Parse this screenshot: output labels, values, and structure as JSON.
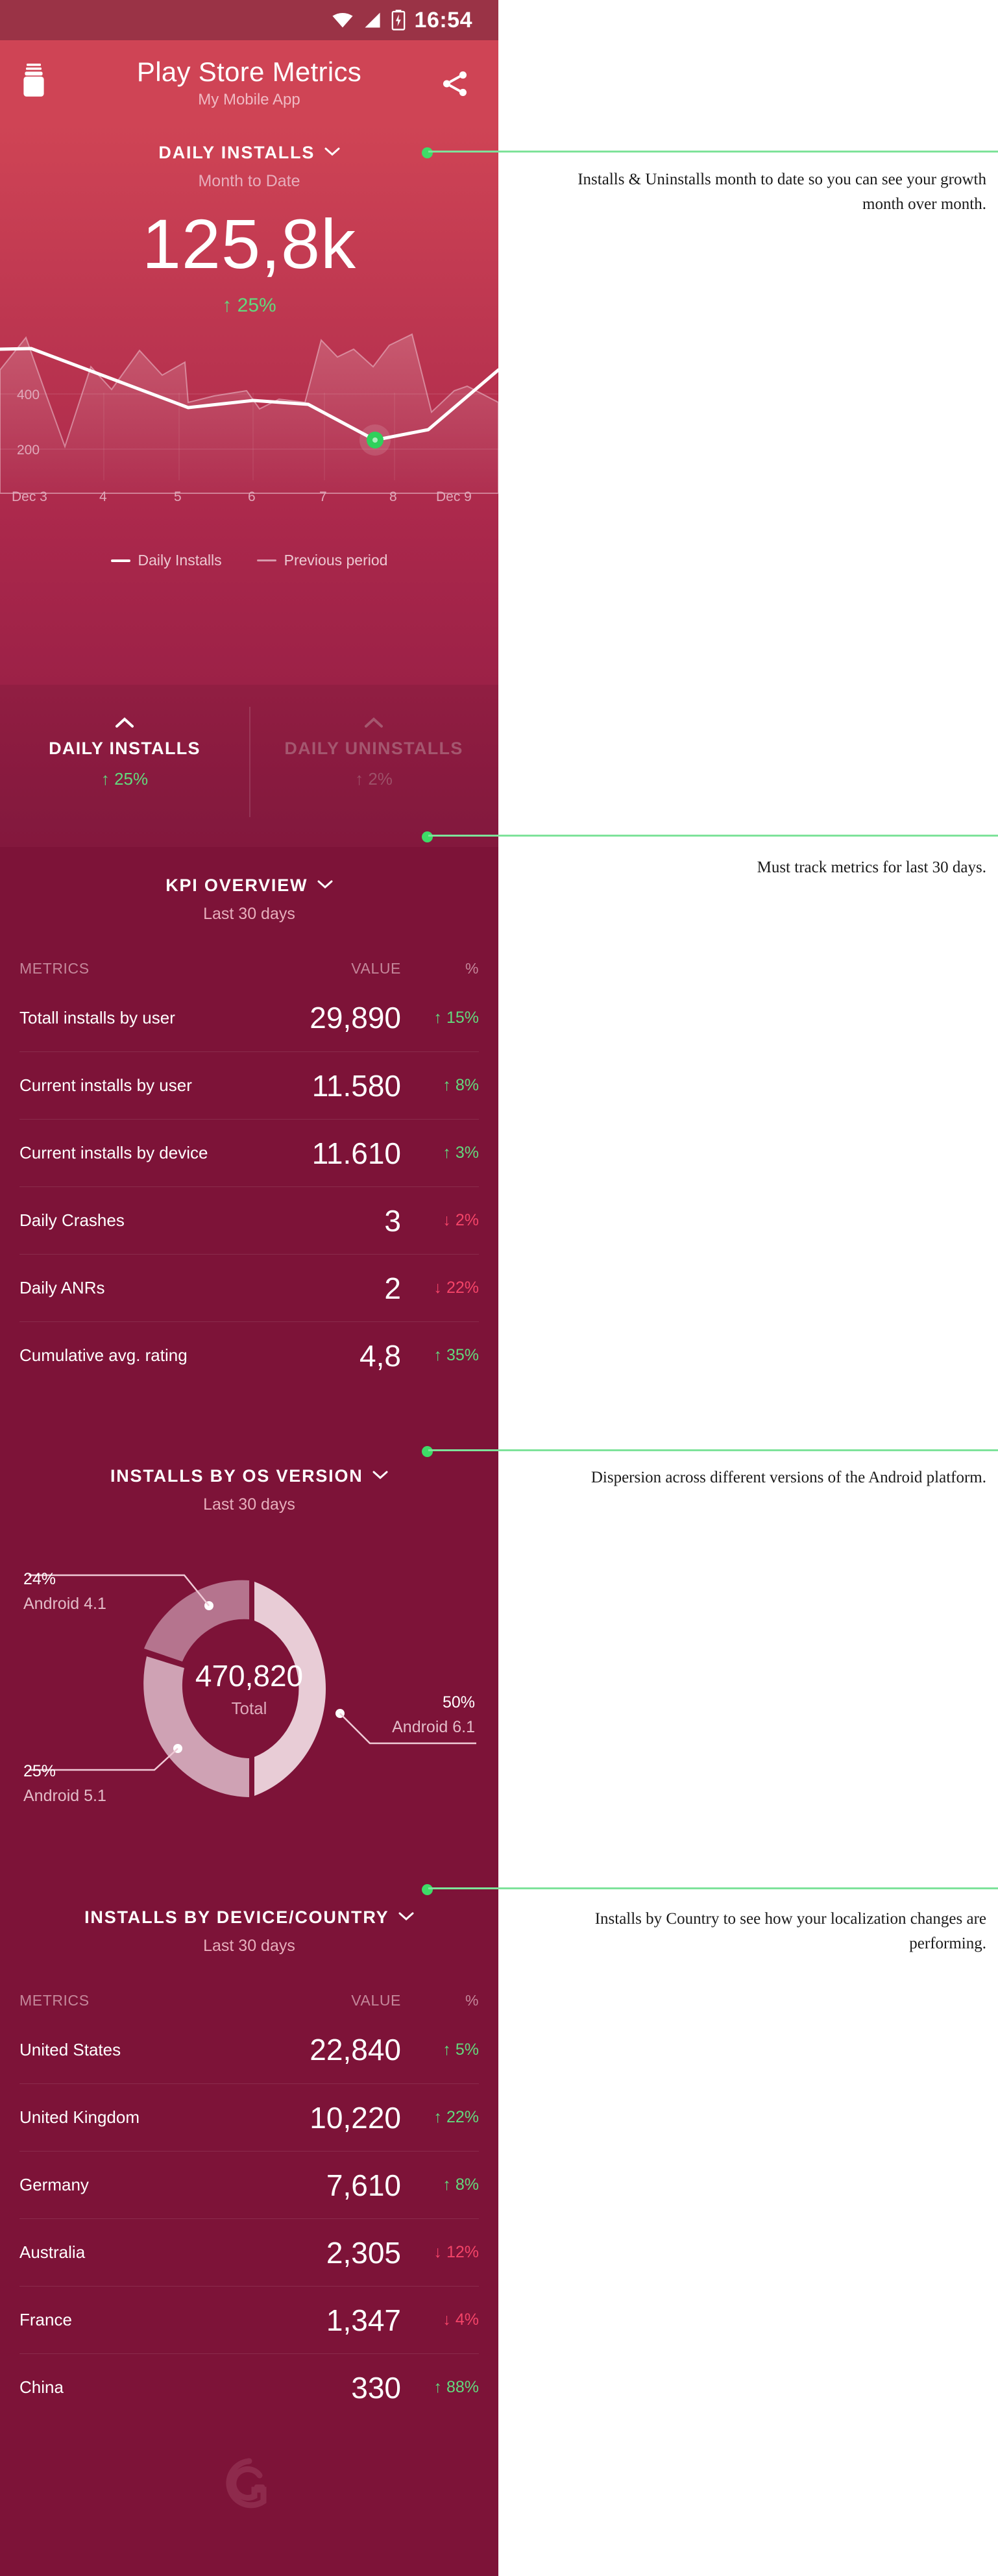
{
  "statusbar": {
    "time": "16:54",
    "icons": [
      "wifi-icon",
      "signal-icon",
      "battery-charging-icon"
    ]
  },
  "appbar": {
    "title": "Play Store Metrics",
    "subtitle": "My Mobile App",
    "app_icon": "app-jar-icon",
    "share_icon": "share-icon"
  },
  "hero": {
    "title": "DAILY INSTALLS",
    "caret": "⌄",
    "period": "Month to Date",
    "value": "125,8k",
    "delta": "↑ 25%",
    "legend": [
      {
        "label": "Daily Installs",
        "style": "solid"
      },
      {
        "label": "Previous period",
        "style": "faint"
      }
    ],
    "tabs": [
      {
        "label": "DAILY INSTALLS",
        "delta": "↑ 25%",
        "active": true
      },
      {
        "label": "DAILY UNINSTALLS",
        "delta": "↑ 2%",
        "active": false
      }
    ]
  },
  "kpi": {
    "title": "KPI OVERVIEW",
    "period": "Last 30 days",
    "columns": {
      "metrics": "METRICS",
      "value": "VALUE",
      "percent": "%"
    },
    "rows": [
      {
        "metric": "Totall installs by user",
        "value": "29,890",
        "delta": "↑ 15%",
        "dir": "up"
      },
      {
        "metric": "Current installs by user",
        "value": "11.580",
        "delta": "↑ 8%",
        "dir": "up"
      },
      {
        "metric": "Current installs by device",
        "value": "11.610",
        "delta": "↑ 3%",
        "dir": "up"
      },
      {
        "metric": "Daily Crashes",
        "value": "3",
        "delta": "↓ 2%",
        "dir": "down"
      },
      {
        "metric": "Daily ANRs",
        "value": "2",
        "delta": "↓ 22%",
        "dir": "down"
      },
      {
        "metric": "Cumulative avg. rating",
        "value": "4,8",
        "delta": "↑ 35%",
        "dir": "up"
      }
    ]
  },
  "os": {
    "title": "INSTALLS BY OS VERSION",
    "period": "Last 30 days",
    "total_value": "470,820",
    "total_label": "Total"
  },
  "country": {
    "title": "INSTALLS BY DEVICE/COUNTRY",
    "period": "Last 30 days",
    "columns": {
      "metrics": "METRICS",
      "value": "VALUE",
      "percent": "%"
    },
    "rows": [
      {
        "metric": "United States",
        "value": "22,840",
        "delta": "↑ 5%",
        "dir": "up"
      },
      {
        "metric": "United Kingdom",
        "value": "10,220",
        "delta": "↑ 22%",
        "dir": "up"
      },
      {
        "metric": "Germany",
        "value": "7,610",
        "delta": "↑ 8%",
        "dir": "up"
      },
      {
        "metric": "Australia",
        "value": "2,305",
        "delta": "↓ 12%",
        "dir": "down"
      },
      {
        "metric": "France",
        "value": "1,347",
        "delta": "↓ 4%",
        "dir": "down"
      },
      {
        "metric": "China",
        "value": "330",
        "delta": "↑ 88%",
        "dir": "up"
      }
    ]
  },
  "annotations": [
    {
      "text": "Installs & Uninstalls month to date so you can see your growth month over month."
    },
    {
      "text": "Must track metrics for last 30 days."
    },
    {
      "text": "Dispersion across different versions of the Android platform."
    },
    {
      "text": "Installs by Country to see how your localization changes are performing."
    }
  ],
  "colors": {
    "brand_dark": "#7d1338",
    "brand_light": "#cf4455",
    "accent_green": "#3edb67",
    "up": "#62d97d",
    "down": "#f44468"
  },
  "chart_data": [
    {
      "type": "line",
      "title": "Daily Installs",
      "xlabel": "",
      "ylabel": "",
      "ylim": [
        0,
        600
      ],
      "yticks": [
        200,
        400
      ],
      "categories": [
        "Dec 3",
        "4",
        "5",
        "6",
        "7",
        "8",
        "Dec 9"
      ],
      "grid": true,
      "legend": [
        "Daily Installs",
        "Previous period"
      ],
      "legend_position": "bottom",
      "highlight_point": {
        "x": "8",
        "y": 185
      },
      "series": [
        {
          "name": "Daily Installs",
          "values": [
            520,
            522,
            345,
            375,
            358,
            185,
            230,
            420
          ]
        },
        {
          "name": "Previous period",
          "values": [
            470,
            560,
            160,
            400,
            320,
            480,
            410,
            520
          ]
        }
      ]
    },
    {
      "type": "pie",
      "title": "Installs by OS version",
      "center_value": "470,820",
      "center_label": "Total",
      "labels": [
        "Android 6.1",
        "Android 5.1",
        "Android 4.1"
      ],
      "values": [
        50,
        25,
        24
      ],
      "value_labels": [
        "50%",
        "25%",
        "24%"
      ],
      "colors": [
        "#e8ccd6",
        "#cfa2b4",
        "#b5748e"
      ]
    }
  ]
}
